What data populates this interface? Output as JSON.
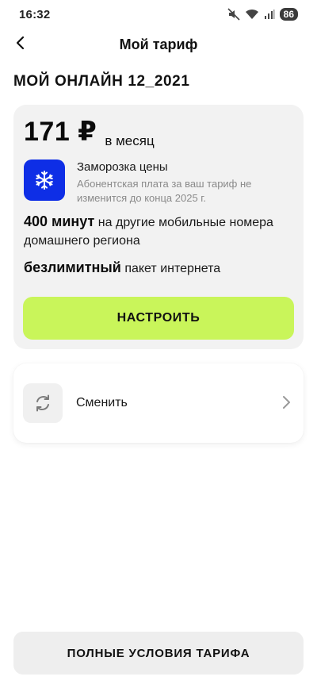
{
  "status_bar": {
    "time": "16:32",
    "icons": [
      "mute-icon",
      "wifi-icon",
      "signal-icon"
    ],
    "battery": "86"
  },
  "header": {
    "title": "Мой тариф",
    "back_icon": "chevron-left-icon"
  },
  "plan": {
    "name": "МОЙ ОНЛАЙН 12_2021"
  },
  "tariff_card": {
    "price": "171 ₽",
    "period": "в месяц",
    "freeze": {
      "icon": "snowflake-icon",
      "title": "Заморозка цены",
      "description": "Абонентская плата за ваш тариф не изменится до конца 2025 г."
    },
    "minutes": {
      "value": "400 минут",
      "text": "на другие мобильные номера домашнего региона"
    },
    "internet": {
      "value": "безлимитный",
      "text": "пакет интернета"
    },
    "configure_label": "НАСТРОИТЬ"
  },
  "change_card": {
    "icon": "refresh-icon",
    "label": "Сменить",
    "chevron": "chevron-right-icon"
  },
  "footer": {
    "full_terms_label": "ПОЛНЫЕ УСЛОВИЯ ТАРИФА"
  },
  "colors": {
    "accent_green": "#c9f55a",
    "freeze_blue": "#0e2ee6",
    "card_bg": "#f2f2f2"
  }
}
